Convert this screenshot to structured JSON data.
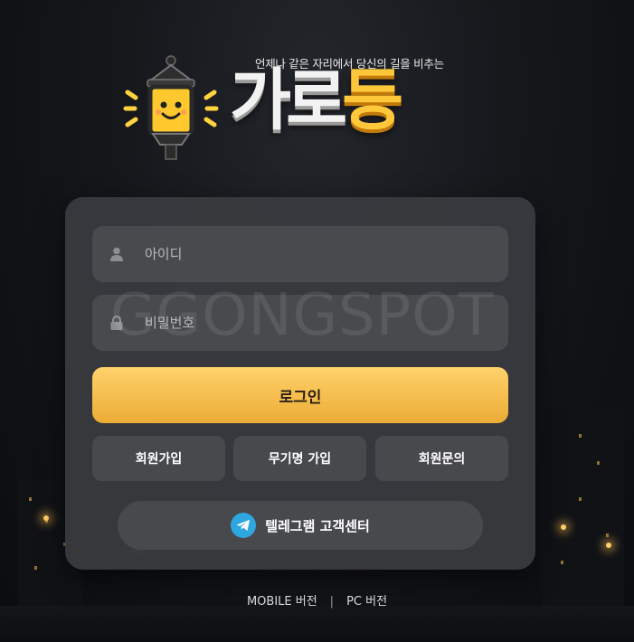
{
  "header": {
    "tagline": "언제나 같은 자리에서 당신의 길을 비추는",
    "logo_part1": "가로",
    "logo_part2": "등"
  },
  "watermark": "GGONGSPOT",
  "login": {
    "id_placeholder": "아이디",
    "pw_placeholder": "비밀번호",
    "login_label": "로그인",
    "signup_label": "회원가입",
    "anon_signup_label": "무기명 가입",
    "inquiry_label": "회원문의",
    "telegram_label": "텔레그램 고객센터"
  },
  "footer": {
    "mobile_label": "MOBILE 버전",
    "separator": "|",
    "pc_label": "PC 버전"
  },
  "colors": {
    "accent": "#f5bd45",
    "telegram": "#2ea6e0"
  },
  "icons": [
    "user-icon",
    "lock-icon",
    "telegram-icon",
    "lamp-logo-icon"
  ]
}
